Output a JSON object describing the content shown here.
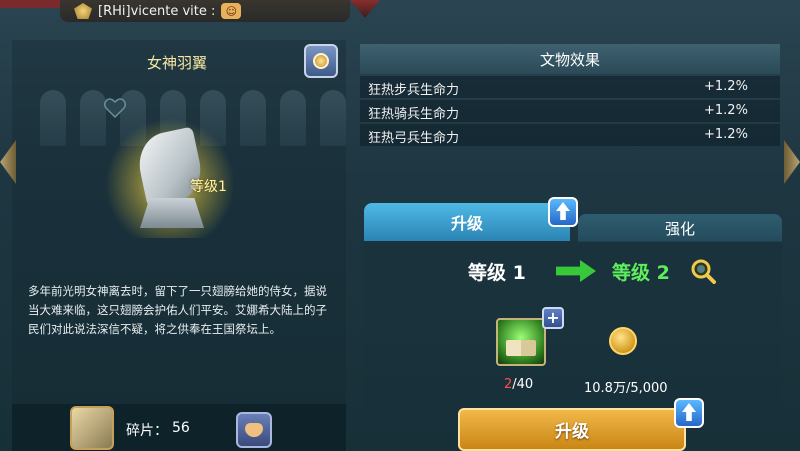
{
  "chat": {
    "sender": "[RHi]vicente vite :"
  },
  "artifact": {
    "name": "女神羽翼",
    "level_label": "等级1",
    "description": "多年前光明女神离去时，留下了一只翅膀给她的侍女，据说当大难来临，这只翅膀会护佑人们平安。艾娜希大陆上的子民们对此说法深信不疑，将之供奉在王国祭坛上。",
    "fragments_label": "碎片：",
    "fragments_value": "56"
  },
  "effects": {
    "title": "文物效果",
    "rows": [
      {
        "name": "狂热步兵生命力",
        "value": "+1.2%"
      },
      {
        "name": "狂热骑兵生命力",
        "value": "+1.2%"
      },
      {
        "name": "狂热弓兵生命力",
        "value": "+1.2%"
      }
    ]
  },
  "tabs": {
    "upgrade": "升级",
    "enhance": "强化"
  },
  "upgrade": {
    "from_level": "等级 1",
    "to_level": "等级 2",
    "book_have": "2",
    "book_need": "/40",
    "gold": "10.8万/5,000",
    "button": "升级"
  },
  "colors": {
    "accent_title": "#f6e7a3",
    "tab_active": "#2b84b3",
    "next_level": "#5ef05c",
    "insufficient": "#ff4d4d",
    "upgrade_button": "#e0a030"
  },
  "icons": {
    "chat_badge": "guild-badge-icon",
    "chat_emoji": "emoji-icon",
    "medal": "medal-icon",
    "favorite": "heart-icon",
    "hand": "offer-hand-icon",
    "book": "tome-icon",
    "gold": "gold-coin-icon",
    "magnify": "magnify-icon",
    "up_arrow": "up-arrow-icon"
  }
}
